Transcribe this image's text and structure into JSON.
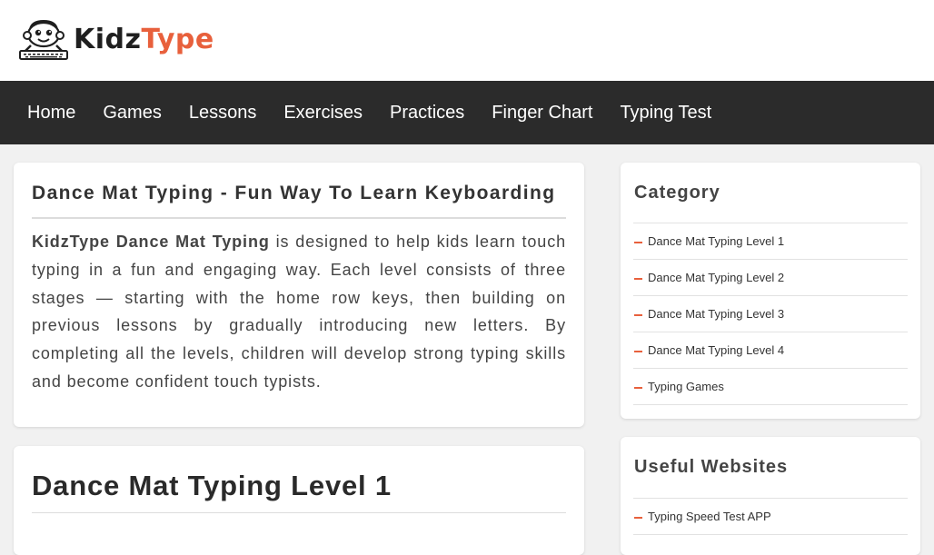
{
  "brand": {
    "name_part1": "Kidz",
    "name_part2": "Type",
    "accent_color": "#e8603c",
    "logo_icon": "kid-at-keyboard-icon"
  },
  "nav": {
    "items": [
      {
        "label": "Home"
      },
      {
        "label": "Games"
      },
      {
        "label": "Lessons"
      },
      {
        "label": "Exercises"
      },
      {
        "label": "Practices"
      },
      {
        "label": "Finger Chart"
      },
      {
        "label": "Typing Test"
      }
    ]
  },
  "article": {
    "title": "Dance Mat Typing - Fun Way To Learn Keyboarding",
    "intro_bold": "KidzType Dance Mat Typing",
    "intro_rest": " is designed to help kids learn touch typing in a fun and engaging way. Each level consists of three stages — starting with the home row keys, then building on previous lessons by gradually introducing new letters. By completing all the levels, children will develop strong typing skills and become confident touch typists."
  },
  "level_section": {
    "title": "Dance Mat Typing Level 1"
  },
  "sidebar": {
    "category": {
      "title": "Category",
      "items": [
        {
          "label": "Dance Mat Typing Level 1"
        },
        {
          "label": "Dance Mat Typing Level 2"
        },
        {
          "label": "Dance Mat Typing Level 3"
        },
        {
          "label": "Dance Mat Typing Level 4"
        },
        {
          "label": "Typing Games"
        }
      ]
    },
    "useful": {
      "title": "Useful Websites",
      "items": [
        {
          "label": "Typing Speed Test APP"
        }
      ]
    }
  }
}
